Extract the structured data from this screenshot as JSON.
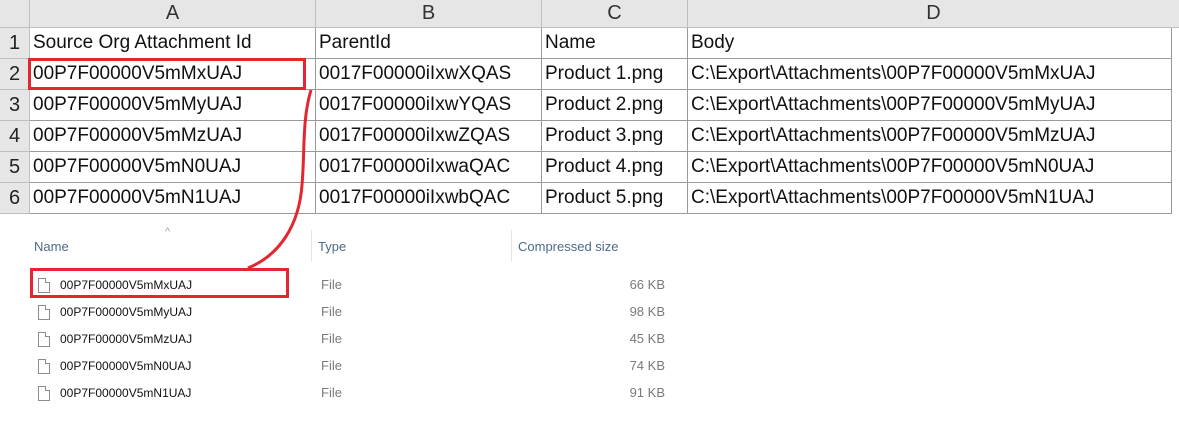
{
  "spreadsheet": {
    "column_letters": [
      "A",
      "B",
      "C",
      "D"
    ],
    "row_numbers": [
      "1",
      "2",
      "3",
      "4",
      "5",
      "6"
    ],
    "headers": [
      "Source  Org  Attachment  Id",
      "ParentId",
      "Name",
      "Body"
    ],
    "rows": [
      [
        "00P7F00000V5mMxUAJ",
        "0017F00000iIxwXQAS",
        "Product 1.png",
        "C:\\Export\\Attachments\\00P7F00000V5mMxUAJ"
      ],
      [
        "00P7F00000V5mMyUAJ",
        "0017F00000iIxwYQAS",
        "Product 2.png",
        "C:\\Export\\Attachments\\00P7F00000V5mMyUAJ"
      ],
      [
        "00P7F00000V5mMzUAJ",
        "0017F00000iIxwZQAS",
        "Product 3.png",
        "C:\\Export\\Attachments\\00P7F00000V5mMzUAJ"
      ],
      [
        "00P7F00000V5mN0UAJ",
        "0017F00000iIxwaQAC",
        "Product 4.png",
        "C:\\Export\\Attachments\\00P7F00000V5mN0UAJ"
      ],
      [
        "00P7F00000V5mN1UAJ",
        "0017F00000iIxwbQAC",
        "Product 5.png",
        "C:\\Export\\Attachments\\00P7F00000V5mN1UAJ"
      ]
    ]
  },
  "explorer": {
    "columns": [
      "Name",
      "Type",
      "Compressed size"
    ],
    "sort_indicator": "^",
    "files": [
      {
        "name": "00P7F00000V5mMxUAJ",
        "type": "File",
        "size": "66 KB",
        "icon": "file-icon"
      },
      {
        "name": "00P7F00000V5mMyUAJ",
        "type": "File",
        "size": "98 KB",
        "icon": "file-icon"
      },
      {
        "name": "00P7F00000V5mMzUAJ",
        "type": "File",
        "size": "45 KB",
        "icon": "file-icon"
      },
      {
        "name": "00P7F00000V5mN0UAJ",
        "type": "File",
        "size": "74 KB",
        "icon": "file-icon"
      },
      {
        "name": "00P7F00000V5mN1UAJ",
        "type": "File",
        "size": "91 KB",
        "icon": "file-icon"
      }
    ]
  },
  "colors": {
    "highlight": "#e3262f",
    "header_bg": "#e6e6e6",
    "explorer_header_text": "#4d6a86"
  }
}
